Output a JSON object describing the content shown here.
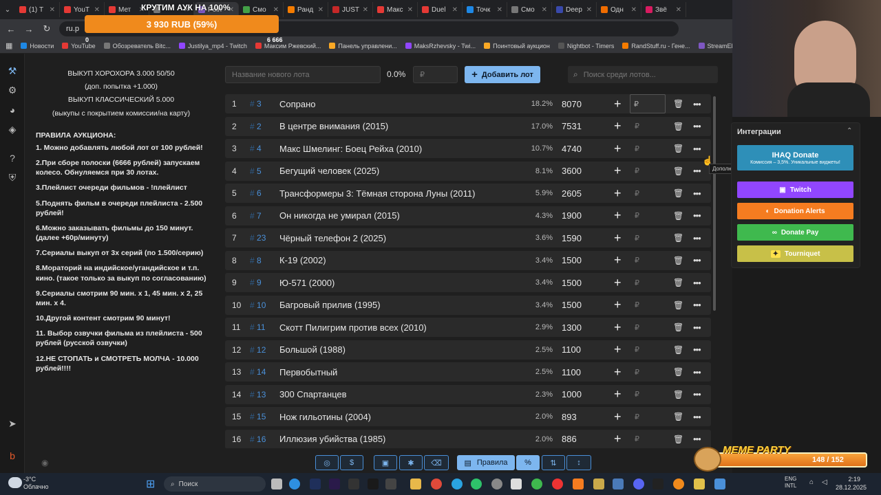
{
  "tabs": [
    {
      "label": "(1) Т",
      "color": "#e53935"
    },
    {
      "label": "YouT",
      "color": "#e53935"
    },
    {
      "label": "Мет",
      "color": "#e53935"
    },
    {
      "label": "",
      "color": "#777"
    },
    {
      "label": "Poin",
      "color": "#7e57c2",
      "active": true
    },
    {
      "label": "Смо",
      "color": "#43a047"
    },
    {
      "label": "Ранд",
      "color": "#f57c00"
    },
    {
      "label": "JUST",
      "color": "#c62828"
    },
    {
      "label": "Макс",
      "color": "#e53935"
    },
    {
      "label": "Duel",
      "color": "#e53935"
    },
    {
      "label": "Точк",
      "color": "#1e88e5"
    },
    {
      "label": "Смо",
      "color": "#777"
    },
    {
      "label": "Deep",
      "color": "#3949ab"
    },
    {
      "label": "Одн",
      "color": "#ef6c00"
    },
    {
      "label": "Звё",
      "color": "#d81b60"
    }
  ],
  "address": {
    "url": "ru.p"
  },
  "bookmarks": [
    {
      "label": "Новости",
      "color": "#1e88e5"
    },
    {
      "label": "YouTube",
      "color": "#e53935"
    },
    {
      "label": "Обозреватель Bitc...",
      "color": "#777"
    },
    {
      "label": "Justilya_mp4 - Twitch",
      "color": "#9146ff"
    },
    {
      "label": "Максим Ржевский...",
      "color": "#e53935"
    },
    {
      "label": "Панель управлени...",
      "color": "#f9a825"
    },
    {
      "label": "MaksRzhevsky - Twi...",
      "color": "#9146ff"
    },
    {
      "label": "Поинтовый аукцион",
      "color": "#f9a825"
    },
    {
      "label": "Nightbot - Timers",
      "color": "#555"
    },
    {
      "label": "RandStuff.ru - Гене...",
      "color": "#f57c00"
    },
    {
      "label": "StreamElements - M...",
      "color": "#7e57c2"
    }
  ],
  "overlay": {
    "title": "КРУТИМ АУК НА 100%",
    "progress_text": "3 930 RUB (59%)",
    "progress_fraction": 0.59,
    "min": "0",
    "max": "6 666"
  },
  "rules": {
    "lines_center": [
      "ВЫКУП ХОРОХОРА 3.000 50/50",
      "(доп. попытка +1.000)",
      "ВЫКУП КЛАССИЧЕСКИЙ 5.000",
      "(выкупы с покрытием комиссии/на карту)"
    ],
    "heading": "ПРАВИЛА АУКЦИОНА:",
    "items": [
      "1. Можно добавлять любой лот от 100 рублей!",
      "2.При сборе полоски (6666 рублей) запускаем колесо. Обнуляемся при 30 лотах.",
      "3.Плейлист очереди фильмов - !плейлист",
      "5.Поднять фильм в очереди плейлиста - 2.500 рублей!",
      "6.Можно заказывать фильмы до 150 минут. (далее +60р/минуту)",
      "7.Сериалы выкуп от 3х серий (по 1.500/серию)",
      "8.Мораторий на индийское/угандийское и т.п. кино. (такое только за выкуп по согласованию)",
      "9.Сериалы смотрим 90 мин. х 1, 45 мин. х 2, 25 мин. х 4.",
      "10.Другой контент смотрим 90 минут!",
      "11. Выбор озвучки фильма из плейлиста - 500 рублей (русской озвучки)",
      "12.НЕ СТОПАТЬ и СМОТРЕТЬ МОЛЧА - 10.000 рублей!!!!"
    ]
  },
  "toolbar": {
    "lot_placeholder": "Название нового лота",
    "percent": "0.0%",
    "rub_placeholder": "₽",
    "add_label": "Добавить лот",
    "search_placeholder": "Поиск среди лотов..."
  },
  "lots": [
    {
      "num": "1",
      "id": "3",
      "name": "Сопрано",
      "pct": "18.2%",
      "amount": "8070"
    },
    {
      "num": "2",
      "id": "2",
      "name": "В центре внимания (2015)",
      "pct": "17.0%",
      "amount": "7531"
    },
    {
      "num": "3",
      "id": "4",
      "name": "Макс Шмелинг: Боец Рейха (2010)",
      "pct": "10.7%",
      "amount": "4740"
    },
    {
      "num": "4",
      "id": "5",
      "name": "Бегущий человек (2025)",
      "pct": "8.1%",
      "amount": "3600"
    },
    {
      "num": "5",
      "id": "6",
      "name": "Трансформеры 3: Тёмная сторона Луны (2011)",
      "pct": "5.9%",
      "amount": "2605"
    },
    {
      "num": "6",
      "id": "7",
      "name": "Он никогда не умирал (2015)",
      "pct": "4.3%",
      "amount": "1900"
    },
    {
      "num": "7",
      "id": "23",
      "name": "Чёрный телефон 2 (2025)",
      "pct": "3.6%",
      "amount": "1590"
    },
    {
      "num": "8",
      "id": "8",
      "name": "К-19 (2002)",
      "pct": "3.4%",
      "amount": "1500"
    },
    {
      "num": "9",
      "id": "9",
      "name": "Ю-571 (2000)",
      "pct": "3.4%",
      "amount": "1500"
    },
    {
      "num": "10",
      "id": "10",
      "name": "Багровый прилив (1995)",
      "pct": "3.4%",
      "amount": "1500"
    },
    {
      "num": "11",
      "id": "11",
      "name": "Скотт Пилигрим против всех (2010)",
      "pct": "2.9%",
      "amount": "1300"
    },
    {
      "num": "12",
      "id": "12",
      "name": "Большой (1988)",
      "pct": "2.5%",
      "amount": "1100"
    },
    {
      "num": "13",
      "id": "14",
      "name": "Первобытный",
      "pct": "2.5%",
      "amount": "1100"
    },
    {
      "num": "14",
      "id": "13",
      "name": "300 Спартанцев",
      "pct": "2.3%",
      "amount": "1000"
    },
    {
      "num": "15",
      "id": "15",
      "name": "Нож гильотины (2004)",
      "pct": "2.0%",
      "amount": "893"
    },
    {
      "num": "16",
      "id": "16",
      "name": "Иллюзия убийства (1985)",
      "pct": "2.0%",
      "amount": "886"
    }
  ],
  "lot_rub_symbol": "₽",
  "tooltip": "Дополнительно",
  "bottom": {
    "rules_label": "Правила"
  },
  "integrations": {
    "title": "Интеграции",
    "ihaq_label": "IHAQ Donate",
    "ihaq_sub": "Комиссия – 3,5%. Уникальные виджеты!",
    "twitch": "Twitch",
    "donation_alerts": "Donation Alerts",
    "donate_pay": "Donate Pay",
    "tourniquet": "Tourniquet",
    "colors": {
      "ihaq": "#2e8fb8",
      "twitch": "#9146ff",
      "da": "#f57c20",
      "dp": "#3fb94e",
      "tq": "#c8c048"
    }
  },
  "meme": {
    "title": "MEME PARTY",
    "count": "148 / 152"
  },
  "taskbar": {
    "temp": "-3°C",
    "weather": "Облачно",
    "search": "Поиск",
    "lang1": "ENG",
    "lang2": "INTL",
    "time": "2:19",
    "date": "28.12.2025"
  }
}
